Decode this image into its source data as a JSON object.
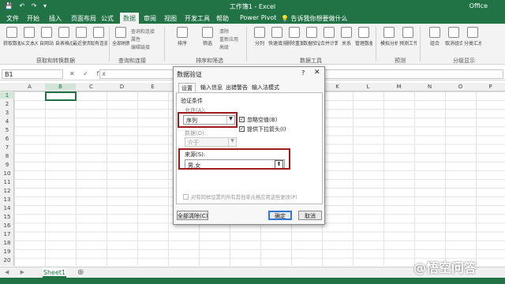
{
  "window": {
    "qa_icons": "💾 ↶ ↷ ▾",
    "title": "工作簿1  -  Excel",
    "office": "Office"
  },
  "menu": [
    {
      "label": "文件"
    },
    {
      "label": "开始"
    },
    {
      "label": "插入"
    },
    {
      "label": "页面布局"
    },
    {
      "label": "公式"
    },
    {
      "label": "数据"
    },
    {
      "label": "审阅"
    },
    {
      "label": "视图"
    },
    {
      "label": "开发工具"
    },
    {
      "label": "帮助"
    },
    {
      "label": "Power Pivot"
    },
    {
      "label": "💡 告诉我你想要做什么"
    }
  ],
  "ribbon": {
    "buttons": [
      {
        "label": "获取数据"
      },
      {
        "label": "从文本/CSV"
      },
      {
        "label": "自网站"
      },
      {
        "label": "自表格/区域"
      },
      {
        "label": "最近使用的源"
      },
      {
        "label": "现有连接"
      },
      {
        "label": "全部刷新"
      },
      {
        "label": "排序"
      },
      {
        "label": "筛选"
      },
      {
        "label": "分列"
      },
      {
        "label": "快速填充"
      },
      {
        "label": "删除重复值"
      },
      {
        "label": "数据验证"
      },
      {
        "label": "合并计算"
      },
      {
        "label": "关系"
      },
      {
        "label": "管理数据模型"
      },
      {
        "label": "模拟分析"
      },
      {
        "label": "预测工作表"
      },
      {
        "label": "组合"
      },
      {
        "label": "取消组合"
      },
      {
        "label": "分类汇总"
      }
    ],
    "small": {
      "queries": "查询和连接",
      "properties": "属性",
      "edit_links": "编辑链接",
      "clear": "清除",
      "reapply": "重新应用",
      "advanced": "高级"
    },
    "groups": {
      "get_transform": "获取和转换数据",
      "queries_connections": "查询和连接",
      "sort_filter": "排序和筛选",
      "data_tools": "数据工具",
      "forecast": "预测",
      "outline": "分级显示"
    }
  },
  "formula_bar": {
    "name_box": "B1",
    "icons": "✕ ✓ fx",
    "value": ""
  },
  "columns": [
    "A",
    "B",
    "C",
    "D",
    "E",
    "F",
    "G",
    "H",
    "I",
    "J",
    "K",
    "L",
    "M",
    "N",
    "O",
    "P"
  ],
  "rows": [
    "1",
    "2",
    "3",
    "4",
    "5",
    "6",
    "7",
    "8",
    "9",
    "10",
    "11",
    "12",
    "13",
    "14",
    "15",
    "16",
    "17",
    "18",
    "19",
    "20"
  ],
  "sheets": {
    "nav": "◀ ▶",
    "tabs": [
      {
        "label": "Sheet1"
      }
    ],
    "add": "⊕"
  },
  "watermark": "@悟空问答",
  "dialog": {
    "title": "数据验证",
    "help": "?",
    "close": "✕",
    "tabs": [
      {
        "label": "设置"
      },
      {
        "label": "输入信息"
      },
      {
        "label": "出错警告"
      },
      {
        "label": "输入法模式"
      }
    ],
    "section_title": "验证条件",
    "allow_label": "允许(A):",
    "allow_value": "序列",
    "ignore_blank": "忽略空值(B)",
    "ignore_blank_mark": "✓",
    "in_cell_dropdown": "提供下拉箭头(I)",
    "in_cell_dropdown_mark": "✓",
    "data_label": "数据(D):",
    "data_value": "介于",
    "source_label": "来源(S):",
    "source_value": "男,女",
    "collapse_icon": "⬆",
    "apply_all": "对有同样设置的所有其他单元格应用这些更改(P)",
    "clear_all": "全部清除(C)",
    "ok": "确定",
    "cancel": "取消"
  },
  "colors": {
    "excel_green": "#217346",
    "highlight_red": "#9e1c1c"
  }
}
